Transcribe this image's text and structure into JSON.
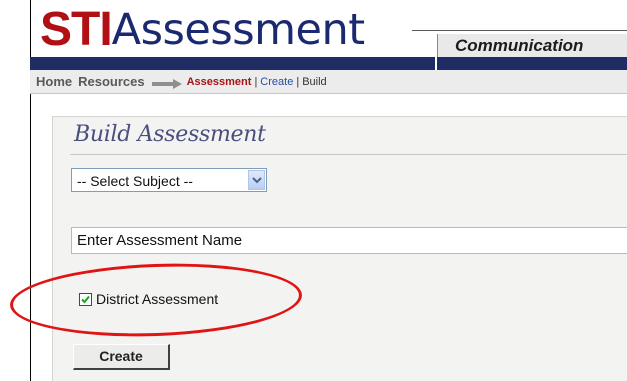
{
  "header": {
    "logo_sti": "STI",
    "logo_word": "Assessment",
    "comm_label": "Communication"
  },
  "breadcrumb": {
    "home": "Home",
    "resources": "Resources",
    "assessment": "Assessment",
    "sep1": "|",
    "create": "Create",
    "sep2": "|",
    "build": "Build"
  },
  "panel": {
    "title": "Build Assessment",
    "subject_select": {
      "selected": "-- Select Subject --"
    },
    "name_input": {
      "value": "Enter Assessment Name"
    },
    "district_checkbox": {
      "label": "District Assessment",
      "checked": true
    },
    "create_button": "Create"
  },
  "colors": {
    "brand_red": "#b01014",
    "brand_navy": "#1f2d64",
    "highlight_oval": "#e01414"
  }
}
